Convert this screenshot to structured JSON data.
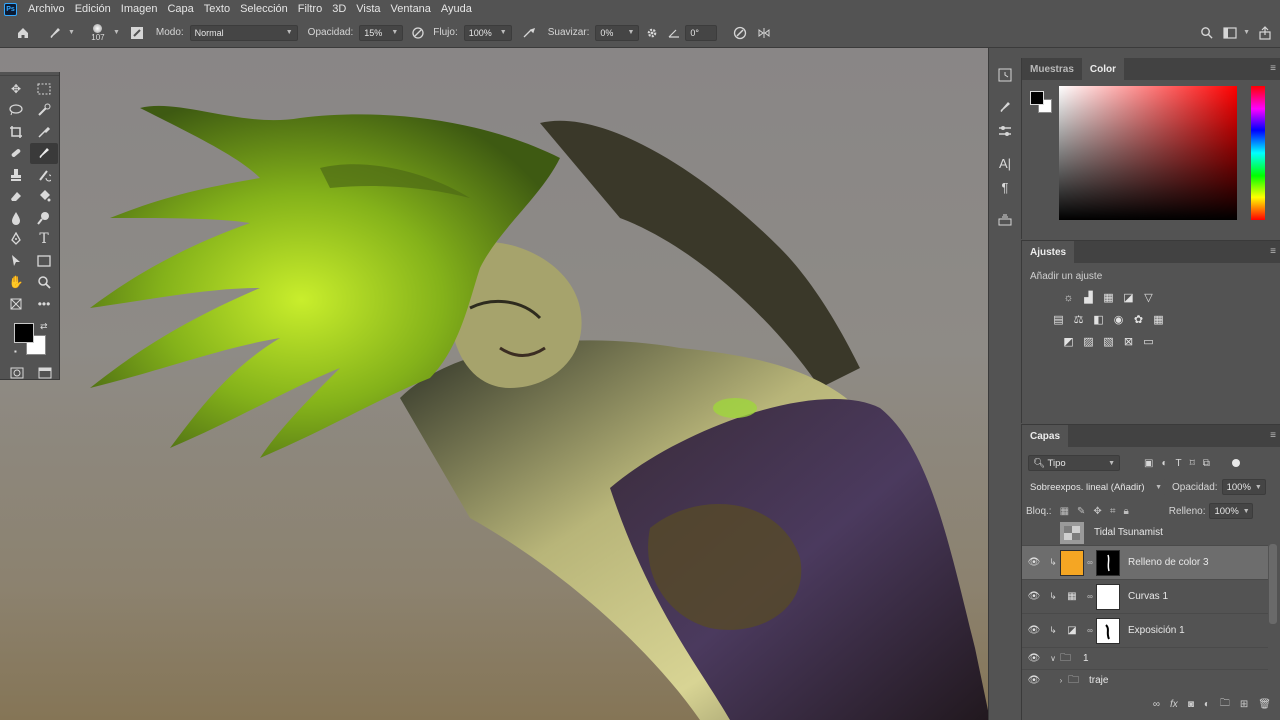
{
  "menubar": {
    "logo": "Ps",
    "items": [
      "Archivo",
      "Edición",
      "Imagen",
      "Capa",
      "Texto",
      "Selección",
      "Filtro",
      "3D",
      "Vista",
      "Ventana",
      "Ayuda"
    ]
  },
  "options": {
    "brush_size": "107",
    "mode_label": "Modo:",
    "mode_value": "Normal",
    "opacity_label": "Opacidad:",
    "opacity_value": "15%",
    "flow_label": "Flujo:",
    "flow_value": "100%",
    "smooth_label": "Suavizar:",
    "smooth_value": "0%",
    "angle_value": "0°"
  },
  "tools": {
    "items": [
      "move-icon",
      "marquee-icon",
      "lasso-icon",
      "quick-select-icon",
      "crop-icon",
      "eyedropper-icon",
      "healing-icon",
      "brush-icon",
      "stamp-icon",
      "history-brush-icon",
      "eraser-icon",
      "bucket-icon",
      "blur-icon",
      "dodge-icon",
      "pen-icon",
      "type-icon",
      "path-select-icon",
      "rectangle-icon",
      "hand-icon",
      "zoom-icon",
      "frame-icon",
      "more-icon"
    ],
    "foreground_color": "#000000",
    "background_color": "#ffffff"
  },
  "color_panel": {
    "tabs": [
      "Muestras",
      "Color"
    ],
    "active_tab": "Color"
  },
  "adjustments": {
    "title": "Ajustes",
    "subtitle": "Añadir un ajuste"
  },
  "layers": {
    "title": "Capas",
    "filter_value": "Tipo",
    "blend_mode": "Sobreexpos. lineal (Añadir)",
    "opacity_label": "Opacidad:",
    "opacity_value": "100%",
    "lock_label": "Bloq.:",
    "fill_label": "Relleno:",
    "fill_value": "100%",
    "items": [
      {
        "name": "Tidal Tsunamist"
      },
      {
        "name": "Relleno de color 3"
      },
      {
        "name": "Curvas 1"
      },
      {
        "name": "Exposición 1"
      },
      {
        "name": "1"
      },
      {
        "name": "traje"
      }
    ],
    "fill_color": "#f5a623"
  }
}
